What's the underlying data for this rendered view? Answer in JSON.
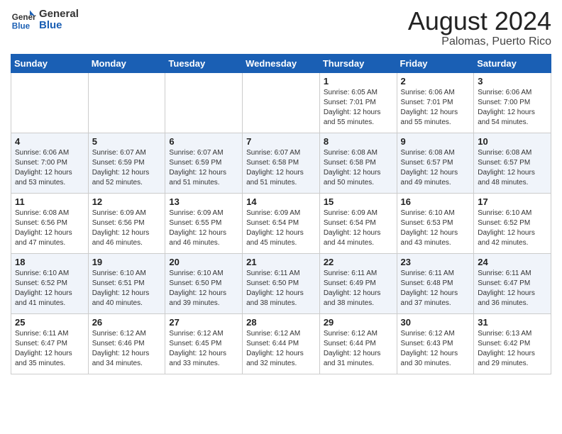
{
  "header": {
    "logo_line1": "General",
    "logo_line2": "Blue",
    "month_year": "August 2024",
    "location": "Palomas, Puerto Rico"
  },
  "weekdays": [
    "Sunday",
    "Monday",
    "Tuesday",
    "Wednesday",
    "Thursday",
    "Friday",
    "Saturday"
  ],
  "weeks": [
    [
      {
        "day": "",
        "info": ""
      },
      {
        "day": "",
        "info": ""
      },
      {
        "day": "",
        "info": ""
      },
      {
        "day": "",
        "info": ""
      },
      {
        "day": "1",
        "info": "Sunrise: 6:05 AM\nSunset: 7:01 PM\nDaylight: 12 hours\nand 55 minutes."
      },
      {
        "day": "2",
        "info": "Sunrise: 6:06 AM\nSunset: 7:01 PM\nDaylight: 12 hours\nand 55 minutes."
      },
      {
        "day": "3",
        "info": "Sunrise: 6:06 AM\nSunset: 7:00 PM\nDaylight: 12 hours\nand 54 minutes."
      }
    ],
    [
      {
        "day": "4",
        "info": "Sunrise: 6:06 AM\nSunset: 7:00 PM\nDaylight: 12 hours\nand 53 minutes."
      },
      {
        "day": "5",
        "info": "Sunrise: 6:07 AM\nSunset: 6:59 PM\nDaylight: 12 hours\nand 52 minutes."
      },
      {
        "day": "6",
        "info": "Sunrise: 6:07 AM\nSunset: 6:59 PM\nDaylight: 12 hours\nand 51 minutes."
      },
      {
        "day": "7",
        "info": "Sunrise: 6:07 AM\nSunset: 6:58 PM\nDaylight: 12 hours\nand 51 minutes."
      },
      {
        "day": "8",
        "info": "Sunrise: 6:08 AM\nSunset: 6:58 PM\nDaylight: 12 hours\nand 50 minutes."
      },
      {
        "day": "9",
        "info": "Sunrise: 6:08 AM\nSunset: 6:57 PM\nDaylight: 12 hours\nand 49 minutes."
      },
      {
        "day": "10",
        "info": "Sunrise: 6:08 AM\nSunset: 6:57 PM\nDaylight: 12 hours\nand 48 minutes."
      }
    ],
    [
      {
        "day": "11",
        "info": "Sunrise: 6:08 AM\nSunset: 6:56 PM\nDaylight: 12 hours\nand 47 minutes."
      },
      {
        "day": "12",
        "info": "Sunrise: 6:09 AM\nSunset: 6:56 PM\nDaylight: 12 hours\nand 46 minutes."
      },
      {
        "day": "13",
        "info": "Sunrise: 6:09 AM\nSunset: 6:55 PM\nDaylight: 12 hours\nand 46 minutes."
      },
      {
        "day": "14",
        "info": "Sunrise: 6:09 AM\nSunset: 6:54 PM\nDaylight: 12 hours\nand 45 minutes."
      },
      {
        "day": "15",
        "info": "Sunrise: 6:09 AM\nSunset: 6:54 PM\nDaylight: 12 hours\nand 44 minutes."
      },
      {
        "day": "16",
        "info": "Sunrise: 6:10 AM\nSunset: 6:53 PM\nDaylight: 12 hours\nand 43 minutes."
      },
      {
        "day": "17",
        "info": "Sunrise: 6:10 AM\nSunset: 6:52 PM\nDaylight: 12 hours\nand 42 minutes."
      }
    ],
    [
      {
        "day": "18",
        "info": "Sunrise: 6:10 AM\nSunset: 6:52 PM\nDaylight: 12 hours\nand 41 minutes."
      },
      {
        "day": "19",
        "info": "Sunrise: 6:10 AM\nSunset: 6:51 PM\nDaylight: 12 hours\nand 40 minutes."
      },
      {
        "day": "20",
        "info": "Sunrise: 6:10 AM\nSunset: 6:50 PM\nDaylight: 12 hours\nand 39 minutes."
      },
      {
        "day": "21",
        "info": "Sunrise: 6:11 AM\nSunset: 6:50 PM\nDaylight: 12 hours\nand 38 minutes."
      },
      {
        "day": "22",
        "info": "Sunrise: 6:11 AM\nSunset: 6:49 PM\nDaylight: 12 hours\nand 38 minutes."
      },
      {
        "day": "23",
        "info": "Sunrise: 6:11 AM\nSunset: 6:48 PM\nDaylight: 12 hours\nand 37 minutes."
      },
      {
        "day": "24",
        "info": "Sunrise: 6:11 AM\nSunset: 6:47 PM\nDaylight: 12 hours\nand 36 minutes."
      }
    ],
    [
      {
        "day": "25",
        "info": "Sunrise: 6:11 AM\nSunset: 6:47 PM\nDaylight: 12 hours\nand 35 minutes."
      },
      {
        "day": "26",
        "info": "Sunrise: 6:12 AM\nSunset: 6:46 PM\nDaylight: 12 hours\nand 34 minutes."
      },
      {
        "day": "27",
        "info": "Sunrise: 6:12 AM\nSunset: 6:45 PM\nDaylight: 12 hours\nand 33 minutes."
      },
      {
        "day": "28",
        "info": "Sunrise: 6:12 AM\nSunset: 6:44 PM\nDaylight: 12 hours\nand 32 minutes."
      },
      {
        "day": "29",
        "info": "Sunrise: 6:12 AM\nSunset: 6:44 PM\nDaylight: 12 hours\nand 31 minutes."
      },
      {
        "day": "30",
        "info": "Sunrise: 6:12 AM\nSunset: 6:43 PM\nDaylight: 12 hours\nand 30 minutes."
      },
      {
        "day": "31",
        "info": "Sunrise: 6:13 AM\nSunset: 6:42 PM\nDaylight: 12 hours\nand 29 minutes."
      }
    ]
  ]
}
